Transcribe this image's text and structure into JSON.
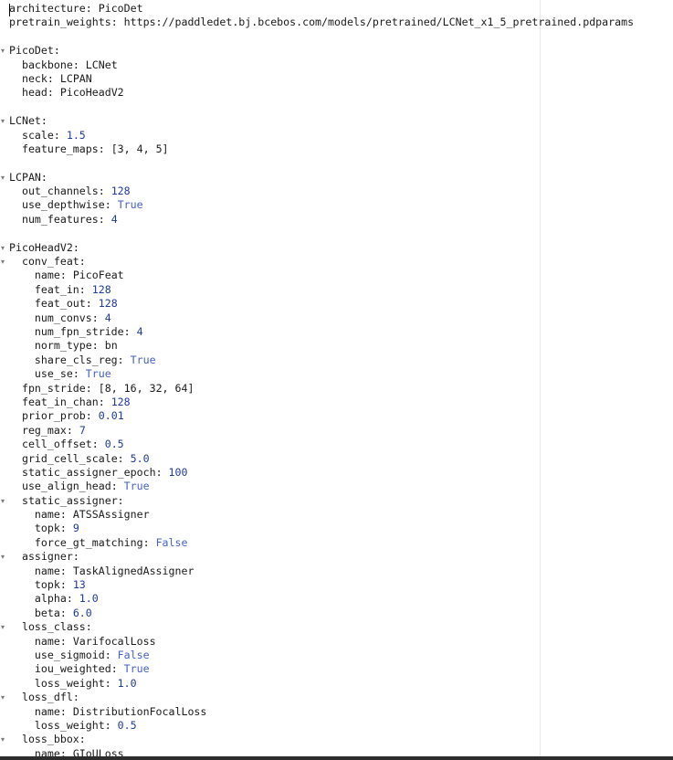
{
  "editor": {
    "lines": [
      {
        "indent": 0,
        "key": "architecture",
        "value": "PicoDet",
        "type": "str"
      },
      {
        "indent": 0,
        "key": "pretrain_weights",
        "value": "https://paddledet.bj.bcebos.com/models/pretrained/LCNet_x1_5_pretrained.pdparams",
        "type": "str"
      },
      {
        "blank": true
      },
      {
        "indent": 0,
        "key": "PicoDet",
        "fold": true
      },
      {
        "indent": 2,
        "key": "backbone",
        "value": "LCNet",
        "type": "str"
      },
      {
        "indent": 2,
        "key": "neck",
        "value": "LCPAN",
        "type": "str"
      },
      {
        "indent": 2,
        "key": "head",
        "value": "PicoHeadV2",
        "type": "str"
      },
      {
        "blank": true
      },
      {
        "indent": 0,
        "key": "LCNet",
        "fold": true
      },
      {
        "indent": 2,
        "key": "scale",
        "value": "1.5",
        "type": "num"
      },
      {
        "indent": 2,
        "key": "feature_maps",
        "value": "[3, 4, 5]",
        "type": "str"
      },
      {
        "blank": true
      },
      {
        "indent": 0,
        "key": "LCPAN",
        "fold": true
      },
      {
        "indent": 2,
        "key": "out_channels",
        "value": "128",
        "type": "num"
      },
      {
        "indent": 2,
        "key": "use_depthwise",
        "value": "True",
        "type": "bool"
      },
      {
        "indent": 2,
        "key": "num_features",
        "value": "4",
        "type": "num"
      },
      {
        "blank": true
      },
      {
        "indent": 0,
        "key": "PicoHeadV2",
        "fold": true
      },
      {
        "indent": 2,
        "key": "conv_feat",
        "fold": true
      },
      {
        "indent": 4,
        "key": "name",
        "value": "PicoFeat",
        "type": "str"
      },
      {
        "indent": 4,
        "key": "feat_in",
        "value": "128",
        "type": "num"
      },
      {
        "indent": 4,
        "key": "feat_out",
        "value": "128",
        "type": "num"
      },
      {
        "indent": 4,
        "key": "num_convs",
        "value": "4",
        "type": "num"
      },
      {
        "indent": 4,
        "key": "num_fpn_stride",
        "value": "4",
        "type": "num"
      },
      {
        "indent": 4,
        "key": "norm_type",
        "value": "bn",
        "type": "str"
      },
      {
        "indent": 4,
        "key": "share_cls_reg",
        "value": "True",
        "type": "bool"
      },
      {
        "indent": 4,
        "key": "use_se",
        "value": "True",
        "type": "bool"
      },
      {
        "indent": 2,
        "key": "fpn_stride",
        "value": "[8, 16, 32, 64]",
        "type": "str"
      },
      {
        "indent": 2,
        "key": "feat_in_chan",
        "value": "128",
        "type": "num"
      },
      {
        "indent": 2,
        "key": "prior_prob",
        "value": "0.01",
        "type": "num"
      },
      {
        "indent": 2,
        "key": "reg_max",
        "value": "7",
        "type": "num"
      },
      {
        "indent": 2,
        "key": "cell_offset",
        "value": "0.5",
        "type": "num"
      },
      {
        "indent": 2,
        "key": "grid_cell_scale",
        "value": "5.0",
        "type": "num"
      },
      {
        "indent": 2,
        "key": "static_assigner_epoch",
        "value": "100",
        "type": "num"
      },
      {
        "indent": 2,
        "key": "use_align_head",
        "value": "True",
        "type": "bool"
      },
      {
        "indent": 2,
        "key": "static_assigner",
        "fold": true
      },
      {
        "indent": 4,
        "key": "name",
        "value": "ATSSAssigner",
        "type": "str"
      },
      {
        "indent": 4,
        "key": "topk",
        "value": "9",
        "type": "num"
      },
      {
        "indent": 4,
        "key": "force_gt_matching",
        "value": "False",
        "type": "bool"
      },
      {
        "indent": 2,
        "key": "assigner",
        "fold": true
      },
      {
        "indent": 4,
        "key": "name",
        "value": "TaskAlignedAssigner",
        "type": "str"
      },
      {
        "indent": 4,
        "key": "topk",
        "value": "13",
        "type": "num"
      },
      {
        "indent": 4,
        "key": "alpha",
        "value": "1.0",
        "type": "num"
      },
      {
        "indent": 4,
        "key": "beta",
        "value": "6.0",
        "type": "num"
      },
      {
        "indent": 2,
        "key": "loss_class",
        "fold": true
      },
      {
        "indent": 4,
        "key": "name",
        "value": "VarifocalLoss",
        "type": "str"
      },
      {
        "indent": 4,
        "key": "use_sigmoid",
        "value": "False",
        "type": "bool"
      },
      {
        "indent": 4,
        "key": "iou_weighted",
        "value": "True",
        "type": "bool"
      },
      {
        "indent": 4,
        "key": "loss_weight",
        "value": "1.0",
        "type": "num"
      },
      {
        "indent": 2,
        "key": "loss_dfl",
        "fold": true
      },
      {
        "indent": 4,
        "key": "name",
        "value": "DistributionFocalLoss",
        "type": "str"
      },
      {
        "indent": 4,
        "key": "loss_weight",
        "value": "0.5",
        "type": "num"
      },
      {
        "indent": 2,
        "key": "loss_bbox",
        "fold": true
      },
      {
        "indent": 4,
        "key": "name",
        "value": "GIoULoss",
        "type": "str"
      }
    ]
  },
  "icons": {
    "fold": "fold-arrow-icon",
    "fold_glyph": "▾"
  },
  "colors": {
    "number": "#1f3a9e",
    "boolean": "#4560c7",
    "text": "#1a1a1a"
  }
}
